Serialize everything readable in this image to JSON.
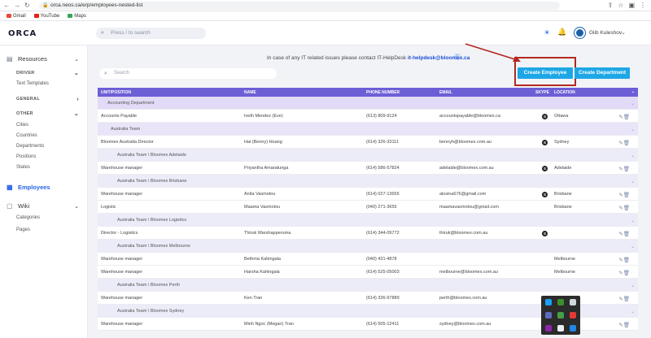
{
  "browser": {
    "url": "orca.neos.ca/erp/employees-nested-list",
    "bookmarks": [
      {
        "label": "Gmail",
        "color": "#e64a3b"
      },
      {
        "label": "YouTube",
        "color": "#e62117"
      },
      {
        "label": "Maps",
        "color": "#34a853"
      }
    ]
  },
  "header": {
    "logo": "ORCA",
    "search_placeholder": "Press / to search",
    "user_name": "Glib Kuleshov"
  },
  "sidebar": {
    "resources": "Resources",
    "driver": "DRIVER",
    "text_templates": "Text Templates",
    "general": "GENERAL",
    "other": "OTHER",
    "other_items": [
      "Cities",
      "Countries",
      "Departments",
      "Positions",
      "States"
    ],
    "employees": "Employees",
    "wiki": "Wiki",
    "wiki_items": [
      "Categories",
      "Pages"
    ]
  },
  "main": {
    "notice_text": "In case of any IT related issues please contact IT-HelpDesk",
    "notice_email": "it-helpdesk@bloomex.ca",
    "search_placeholder": "Search",
    "create_employee": "Create Employee",
    "create_department": "Create Department"
  },
  "table": {
    "columns": {
      "unit": "UNIT/POSITION",
      "name": "NAME",
      "phone": "PHONE NUMBER",
      "email": "EMAIL",
      "skype": "SKYPE",
      "location": "LOCATION"
    },
    "rows": [
      {
        "type": "group",
        "level": 1,
        "unit": "Accounting Department"
      },
      {
        "type": "emp",
        "unit": "Accounts Payable",
        "name": "Iveth Mendez (Eve)",
        "phone": "(613) 809-9124",
        "email": "accountspayable@bloomex.ca",
        "skype": true,
        "location": "Ottawa"
      },
      {
        "type": "group",
        "level": 2,
        "unit": "Australia Team"
      },
      {
        "type": "emp",
        "unit": "Bloomex Australia Director",
        "name": "Hai (Benny) Hoang",
        "phone": "(614) 326-33111",
        "email": "bennyh@bloomex.com.au",
        "skype": true,
        "location": "Sydney"
      },
      {
        "type": "group",
        "level": 3,
        "unit": "Australia Team \\ Bloomex Adelaide"
      },
      {
        "type": "emp",
        "unit": "Warehouse manager",
        "name": "Priyantha Amaratunga",
        "phone": "(614) 586-57824",
        "email": "adelaide@bloomex.com.au",
        "skype": true,
        "location": "Adelaide"
      },
      {
        "type": "group",
        "level": 3,
        "unit": "Australia Team \\ Bloomex Brisbane"
      },
      {
        "type": "emp",
        "unit": "Warehouse manager",
        "name": "Anita Vasmotou",
        "phone": "(614) 027-13655",
        "email": "alosina676@gmail.com",
        "skype": true,
        "location": "Brisbane"
      },
      {
        "type": "emp",
        "unit": "Logistic",
        "name": "Maama Vasmotou",
        "phone": "(040) 271-3655",
        "email": "maamavasmotou@gmail.com",
        "skype": false,
        "location": "Brisbane"
      },
      {
        "type": "group",
        "level": 3,
        "unit": "Australia Team \\ Bloomex Logistics"
      },
      {
        "type": "emp",
        "unit": "Director - Logistics",
        "name": "Thiruk Warshapperuma",
        "phone": "(614) 344-09772",
        "email": "thiruk@bloomex.com.au",
        "skype": true,
        "location": ""
      },
      {
        "type": "group",
        "level": 3,
        "unit": "Australia Team \\ Bloomex Melbourne"
      },
      {
        "type": "emp",
        "unit": "Warehouse manager",
        "name": "Bethma Kahingala",
        "phone": "(040) 431-4878",
        "email": "",
        "skype": false,
        "location": "Melbourne"
      },
      {
        "type": "emp",
        "unit": "Warehouse manager",
        "name": "Harsha Kahingala",
        "phone": "(614) 525-05003",
        "email": "melbourne@bloomex.com.au",
        "skype": false,
        "location": "Melbourne"
      },
      {
        "type": "group",
        "level": 3,
        "unit": "Australia Team \\ Bloomex Perth"
      },
      {
        "type": "emp",
        "unit": "Warehouse manager",
        "name": "Ken Tran",
        "phone": "(614) 336-97889",
        "email": "perth@bloomex.com.au",
        "skype": false,
        "location": ""
      },
      {
        "type": "group",
        "level": 3,
        "unit": "Australia Team \\ Bloomex Sydney"
      },
      {
        "type": "emp",
        "unit": "Warehouse manager",
        "name": "Minh Ngoc (Megan) Tran",
        "phone": "(614) 505-12411",
        "email": "sydney@bloomex.com.au",
        "skype": false,
        "location": ""
      }
    ]
  }
}
